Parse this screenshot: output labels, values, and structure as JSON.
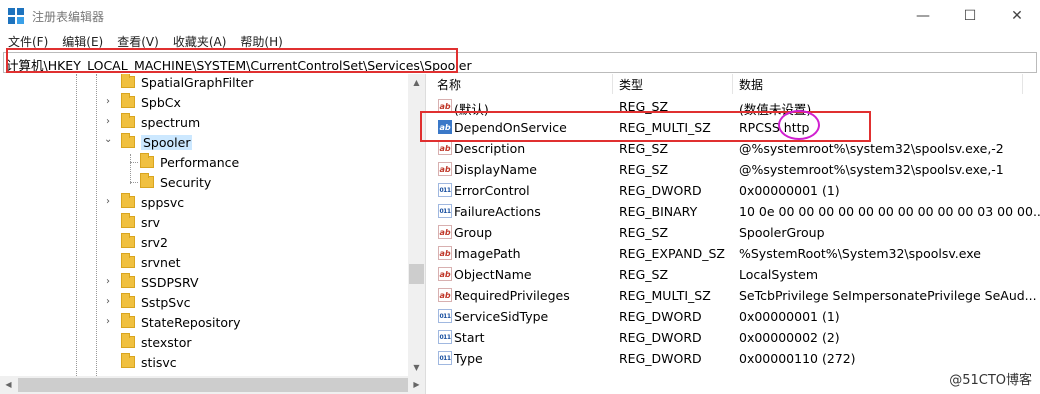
{
  "window": {
    "title": "注册表编辑器",
    "controls": {
      "minimize": "—",
      "maximize": "☐",
      "close": "✕"
    }
  },
  "menu": [
    "文件(F)",
    "编辑(E)",
    "查看(V)",
    "收藏夹(A)",
    "帮助(H)"
  ],
  "address": "计算机\\HKEY_LOCAL_MACHINE\\SYSTEM\\CurrentControlSet\\Services\\Spooler",
  "tree": [
    {
      "label": "SpatialGraphFilter"
    },
    {
      "label": "SpbCx",
      "expander": "›"
    },
    {
      "label": "spectrum",
      "expander": "›"
    },
    {
      "label": "Spooler",
      "expander": "⌄",
      "selected": true
    },
    {
      "label": "Performance",
      "child": true
    },
    {
      "label": "Security",
      "child": true
    },
    {
      "label": "sppsvc",
      "expander": "›"
    },
    {
      "label": "srv"
    },
    {
      "label": "srv2"
    },
    {
      "label": "srvnet"
    },
    {
      "label": "SSDPSRV",
      "expander": "›"
    },
    {
      "label": "SstpSvc",
      "expander": "›"
    },
    {
      "label": "StateRepository",
      "expander": "›"
    },
    {
      "label": "stexstor"
    },
    {
      "label": "stisvc"
    }
  ],
  "columns": {
    "name": "名称",
    "type": "类型",
    "data": "数据"
  },
  "values": [
    {
      "icon": "ab",
      "name": "(默认)",
      "type": "REG_SZ",
      "data": "(数值未设置)"
    },
    {
      "icon": "ab",
      "name": "DependOnService",
      "type": "REG_MULTI_SZ",
      "data": "RPCSS http"
    },
    {
      "icon": "ab",
      "name": "Description",
      "type": "REG_SZ",
      "data": "@%systemroot%\\system32\\spoolsv.exe,-2"
    },
    {
      "icon": "ab",
      "name": "DisplayName",
      "type": "REG_SZ",
      "data": "@%systemroot%\\system32\\spoolsv.exe,-1"
    },
    {
      "icon": "bin",
      "name": "ErrorControl",
      "type": "REG_DWORD",
      "data": "0x00000001 (1)"
    },
    {
      "icon": "bin",
      "name": "FailureActions",
      "type": "REG_BINARY",
      "data": "10 0e 00 00 00 00 00 00 00 00 00 00 03 00 00..."
    },
    {
      "icon": "ab",
      "name": "Group",
      "type": "REG_SZ",
      "data": "SpoolerGroup"
    },
    {
      "icon": "ab",
      "name": "ImagePath",
      "type": "REG_EXPAND_SZ",
      "data": "%SystemRoot%\\System32\\spoolsv.exe"
    },
    {
      "icon": "ab",
      "name": "ObjectName",
      "type": "REG_SZ",
      "data": "LocalSystem"
    },
    {
      "icon": "ab",
      "name": "RequiredPrivileges",
      "type": "REG_MULTI_SZ",
      "data": "SeTcbPrivilege SeImpersonatePrivilege SeAud..."
    },
    {
      "icon": "bin",
      "name": "ServiceSidType",
      "type": "REG_DWORD",
      "data": "0x00000001 (1)"
    },
    {
      "icon": "bin",
      "name": "Start",
      "type": "REG_DWORD",
      "data": "0x00000002 (2)"
    },
    {
      "icon": "bin",
      "name": "Type",
      "type": "REG_DWORD",
      "data": "0x00000110 (272)"
    }
  ],
  "watermark": "@51CTO博客",
  "colors": {
    "selection": "#cce8ff",
    "annotation_box": "#e03030",
    "annotation_circle": "#d020d0"
  }
}
